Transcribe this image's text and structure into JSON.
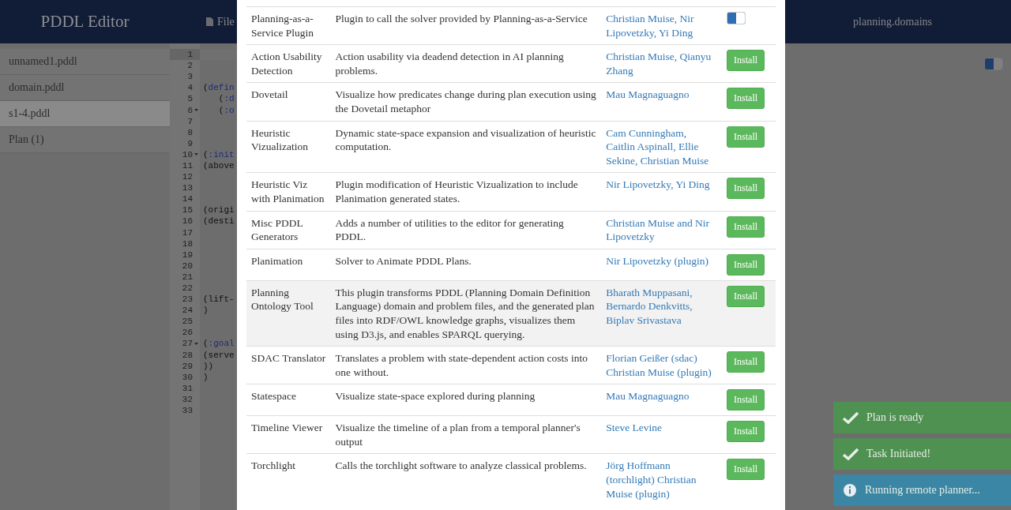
{
  "header": {
    "title": "PDDL Editor",
    "menu": {
      "label": "File"
    },
    "site": "planning.domains"
  },
  "sidebar": {
    "tabs": [
      {
        "label": "unnamed1.pddl",
        "selected": false
      },
      {
        "label": "domain.pddl",
        "selected": false
      },
      {
        "label": "s1-4.pddl",
        "selected": true
      },
      {
        "label": "Plan (1)",
        "selected": false
      }
    ]
  },
  "editor": {
    "toggle": {
      "on": true
    },
    "lines": [
      {
        "number": "1",
        "fold": false,
        "active": true
      },
      {
        "number": "2",
        "fold": false,
        "active": false
      },
      {
        "number": "3",
        "fold": false,
        "active": false
      },
      {
        "number": "4",
        "fold": false,
        "active": false,
        "tokens": [
          {
            "text": "(",
            "kind": "plain"
          },
          {
            "text": "defin",
            "kind": "keyword"
          }
        ]
      },
      {
        "number": "5",
        "fold": false,
        "active": false,
        "tokens": [
          {
            "text": "   (",
            "kind": "plain"
          },
          {
            "text": ":d",
            "kind": "keyword"
          }
        ]
      },
      {
        "number": "6",
        "fold": true,
        "active": false,
        "tokens": [
          {
            "text": "   (",
            "kind": "plain"
          },
          {
            "text": ":o",
            "kind": "keyword"
          }
        ]
      },
      {
        "number": "7",
        "fold": false,
        "active": false
      },
      {
        "number": "8",
        "fold": false,
        "active": false
      },
      {
        "number": "9",
        "fold": false,
        "active": false
      },
      {
        "number": "10",
        "fold": true,
        "active": false,
        "tokens": [
          {
            "text": "(",
            "kind": "plain"
          },
          {
            "text": ":init",
            "kind": "keyword"
          }
        ]
      },
      {
        "number": "11",
        "fold": false,
        "active": false,
        "tokens": [
          {
            "text": "(above",
            "kind": "plain"
          }
        ]
      },
      {
        "number": "12",
        "fold": false,
        "active": false
      },
      {
        "number": "13",
        "fold": false,
        "active": false
      },
      {
        "number": "14",
        "fold": false,
        "active": false
      },
      {
        "number": "15",
        "fold": false,
        "active": false,
        "tokens": [
          {
            "text": "(origi",
            "kind": "plain"
          }
        ]
      },
      {
        "number": "16",
        "fold": false,
        "active": false,
        "tokens": [
          {
            "text": "(desti",
            "kind": "plain"
          }
        ]
      },
      {
        "number": "17",
        "fold": false,
        "active": false
      },
      {
        "number": "18",
        "fold": false,
        "active": false
      },
      {
        "number": "19",
        "fold": false,
        "active": false
      },
      {
        "number": "20",
        "fold": false,
        "active": false
      },
      {
        "number": "21",
        "fold": false,
        "active": false
      },
      {
        "number": "22",
        "fold": false,
        "active": false
      },
      {
        "number": "23",
        "fold": false,
        "active": false,
        "tokens": [
          {
            "text": "(lift-",
            "kind": "plain"
          }
        ]
      },
      {
        "number": "24",
        "fold": false,
        "active": false,
        "tokens": [
          {
            "text": ")",
            "kind": "plain"
          }
        ]
      },
      {
        "number": "25",
        "fold": false,
        "active": false
      },
      {
        "number": "26",
        "fold": false,
        "active": false
      },
      {
        "number": "27",
        "fold": true,
        "active": false,
        "tokens": [
          {
            "text": "(",
            "kind": "plain"
          },
          {
            "text": ":goal",
            "kind": "keyword"
          }
        ]
      },
      {
        "number": "28",
        "fold": false,
        "active": false,
        "tokens": [
          {
            "text": "(serve",
            "kind": "plain"
          }
        ]
      },
      {
        "number": "29",
        "fold": false,
        "active": false,
        "tokens": [
          {
            "text": "))",
            "kind": "plain"
          }
        ]
      },
      {
        "number": "30",
        "fold": false,
        "active": false,
        "tokens": [
          {
            "text": ")",
            "kind": "plain"
          }
        ]
      },
      {
        "number": "31",
        "fold": false,
        "active": false
      },
      {
        "number": "32",
        "fold": false,
        "active": false
      },
      {
        "number": "33",
        "fold": false,
        "active": false
      }
    ]
  },
  "plugins": {
    "rows": [
      {
        "name": "Planning-as-a-Service Plugin",
        "description": "Plugin to call the solver provided by Planning-as-a-Service",
        "authors": "Christian Muise, Nir Lipovetzky, Yi Ding",
        "installed": true,
        "highlighted": false
      },
      {
        "name": "Action Usability Detection",
        "description": "Action usability via deadend detection in AI planning problems.",
        "authors": "Christian Muise, Qianyu Zhang",
        "installed": false,
        "action": "Install",
        "highlighted": false
      },
      {
        "name": "Dovetail",
        "description": "Visualize how predicates change during plan execution using the Dovetail metaphor",
        "authors": "Mau Magnaguagno",
        "installed": false,
        "action": "Install",
        "highlighted": false
      },
      {
        "name": "Heuristic Vizualization",
        "description": "Dynamic state-space expansion and visualization of heuristic computation.",
        "authors": "Cam Cunningham, Caitlin Aspinall, Ellie Sekine, Christian Muise",
        "installed": false,
        "action": "Install",
        "highlighted": false
      },
      {
        "name": "Heuristic Viz with Planimation",
        "description": "Plugin modification of Heuristic Vizualization to include Planimation generated states.",
        "authors": "Nir Lipovetzky, Yi Ding",
        "installed": false,
        "action": "Install",
        "highlighted": false
      },
      {
        "name": "Misc PDDL Generators",
        "description": "Adds a number of utilities to the editor for generating PDDL.",
        "authors": "Christian Muise and Nir Lipovetzky",
        "installed": false,
        "action": "Install",
        "highlighted": false
      },
      {
        "name": "Planimation",
        "description": "Solver to Animate PDDL Plans.",
        "authors": "Nir Lipovetzky (plugin)",
        "installed": false,
        "action": "Install",
        "highlighted": false
      },
      {
        "name": "Planning Ontology Tool",
        "description": "This plugin transforms PDDL (Planning Domain Definition Language) domain and problem files, and the generated plan files into RDF/OWL knowledge graphs, visualizes them using D3.js, and enables SPARQL querying.",
        "authors": "Bharath Muppasani, Bernardo Denkvitts, Biplav Srivastava",
        "installed": false,
        "action": "Install",
        "highlighted": true
      },
      {
        "name": "SDAC Translator",
        "description": "Translates a problem with state-dependent action costs into one without.",
        "authors": "Florian Geißer (sdac) Christian Muise (plugin)",
        "installed": false,
        "action": "Install",
        "highlighted": false
      },
      {
        "name": "Statespace",
        "description": "Visualize state-space explored during planning",
        "authors": "Mau Magnaguagno",
        "installed": false,
        "action": "Install",
        "highlighted": false
      },
      {
        "name": "Timeline Viewer",
        "description": "Visualize the timeline of a plan from a temporal planner's output",
        "authors": "Steve Levine",
        "installed": false,
        "action": "Install",
        "highlighted": false
      },
      {
        "name": "Torchlight",
        "description": "Calls the torchlight software to analyze classical problems.",
        "authors": "Jörg Hoffmann (torchlight) Christian Muise (plugin)",
        "installed": false,
        "action": "Install",
        "highlighted": false
      }
    ]
  },
  "notifications": [
    {
      "kind": "success",
      "text": "Plan is ready"
    },
    {
      "kind": "success",
      "text": "Task Initiated!"
    },
    {
      "kind": "info",
      "text": "Running remote planner..."
    }
  ]
}
